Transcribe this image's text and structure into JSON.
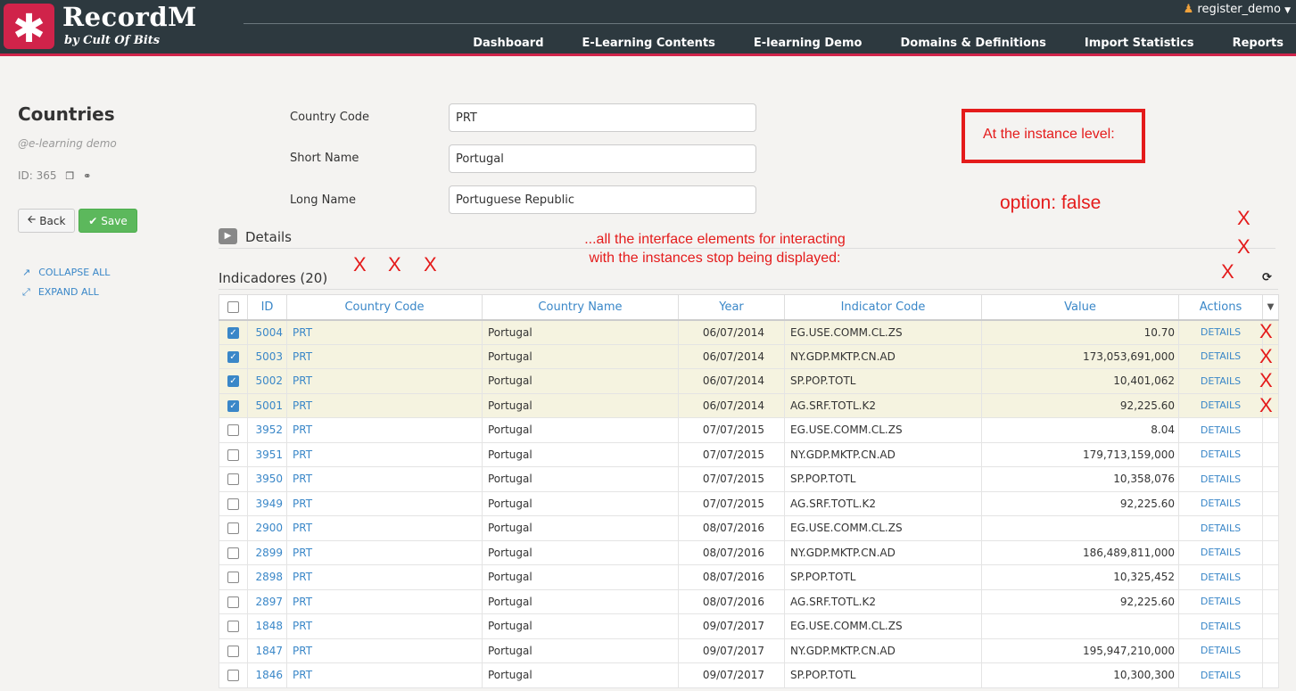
{
  "header": {
    "logo_glyph": "✱",
    "brand": "RecordM",
    "brand_sub": "by Cult Of Bits",
    "user": "register_demo",
    "nav": [
      "Dashboard",
      "E-Learning Contents",
      "E-learning Demo",
      "Domains & Definitions",
      "Import Statistics",
      "Reports"
    ]
  },
  "sidebar": {
    "title": "Countries",
    "subtitle": "@e-learning demo",
    "id_text": "ID: 365",
    "back_label": "Back",
    "save_label": "Save",
    "collapse_label": "COLLAPSE ALL",
    "expand_label": "EXPAND ALL"
  },
  "form": {
    "fields": [
      {
        "label": "Country Code",
        "value": "PRT"
      },
      {
        "label": "Short Name",
        "value": "Portugal"
      },
      {
        "label": "Long Name",
        "value": "Portuguese Republic"
      }
    ],
    "details_label": "Details"
  },
  "table": {
    "title": "Indicadores (20)",
    "columns": [
      "ID",
      "Country Code",
      "Country Name",
      "Year",
      "Indicator Code",
      "Value",
      "Actions"
    ],
    "rows": [
      {
        "checked": true,
        "id": "5004",
        "code": "PRT",
        "name": "Portugal",
        "year": "06/07/2014",
        "indicator": "EG.USE.COMM.CL.ZS",
        "value": "10.70",
        "action": "DETAILS"
      },
      {
        "checked": true,
        "id": "5003",
        "code": "PRT",
        "name": "Portugal",
        "year": "06/07/2014",
        "indicator": "NY.GDP.MKTP.CN.AD",
        "value": "173,053,691,000",
        "action": "DETAILS"
      },
      {
        "checked": true,
        "id": "5002",
        "code": "PRT",
        "name": "Portugal",
        "year": "06/07/2014",
        "indicator": "SP.POP.TOTL",
        "value": "10,401,062",
        "action": "DETAILS"
      },
      {
        "checked": true,
        "id": "5001",
        "code": "PRT",
        "name": "Portugal",
        "year": "06/07/2014",
        "indicator": "AG.SRF.TOTL.K2",
        "value": "92,225.60",
        "action": "DETAILS"
      },
      {
        "checked": false,
        "id": "3952",
        "code": "PRT",
        "name": "Portugal",
        "year": "07/07/2015",
        "indicator": "EG.USE.COMM.CL.ZS",
        "value": "8.04",
        "action": "DETAILS"
      },
      {
        "checked": false,
        "id": "3951",
        "code": "PRT",
        "name": "Portugal",
        "year": "07/07/2015",
        "indicator": "NY.GDP.MKTP.CN.AD",
        "value": "179,713,159,000",
        "action": "DETAILS"
      },
      {
        "checked": false,
        "id": "3950",
        "code": "PRT",
        "name": "Portugal",
        "year": "07/07/2015",
        "indicator": "SP.POP.TOTL",
        "value": "10,358,076",
        "action": "DETAILS"
      },
      {
        "checked": false,
        "id": "3949",
        "code": "PRT",
        "name": "Portugal",
        "year": "07/07/2015",
        "indicator": "AG.SRF.TOTL.K2",
        "value": "92,225.60",
        "action": "DETAILS"
      },
      {
        "checked": false,
        "id": "2900",
        "code": "PRT",
        "name": "Portugal",
        "year": "08/07/2016",
        "indicator": "EG.USE.COMM.CL.ZS",
        "value": "",
        "action": "DETAILS"
      },
      {
        "checked": false,
        "id": "2899",
        "code": "PRT",
        "name": "Portugal",
        "year": "08/07/2016",
        "indicator": "NY.GDP.MKTP.CN.AD",
        "value": "186,489,811,000",
        "action": "DETAILS"
      },
      {
        "checked": false,
        "id": "2898",
        "code": "PRT",
        "name": "Portugal",
        "year": "08/07/2016",
        "indicator": "SP.POP.TOTL",
        "value": "10,325,452",
        "action": "DETAILS"
      },
      {
        "checked": false,
        "id": "2897",
        "code": "PRT",
        "name": "Portugal",
        "year": "08/07/2016",
        "indicator": "AG.SRF.TOTL.K2",
        "value": "92,225.60",
        "action": "DETAILS"
      },
      {
        "checked": false,
        "id": "1848",
        "code": "PRT",
        "name": "Portugal",
        "year": "09/07/2017",
        "indicator": "EG.USE.COMM.CL.ZS",
        "value": "",
        "action": "DETAILS"
      },
      {
        "checked": false,
        "id": "1847",
        "code": "PRT",
        "name": "Portugal",
        "year": "09/07/2017",
        "indicator": "NY.GDP.MKTP.CN.AD",
        "value": "195,947,210,000",
        "action": "DETAILS"
      },
      {
        "checked": false,
        "id": "1846",
        "code": "PRT",
        "name": "Portugal",
        "year": "09/07/2017",
        "indicator": "SP.POP.TOTL",
        "value": "10,300,300",
        "action": "DETAILS"
      }
    ]
  },
  "annotations": {
    "box_text": "At the instance level:",
    "option_text": "option: false",
    "note": "...all the interface elements for interacting with the instances stop being displayed:",
    "x": "X",
    "color": "#e41b1b"
  },
  "colors": {
    "topbar": "#2d393f",
    "brand_accent": "#d0234a",
    "link": "#3a87c8",
    "save": "#5cb85c",
    "selected_row": "#f5f3e0"
  }
}
